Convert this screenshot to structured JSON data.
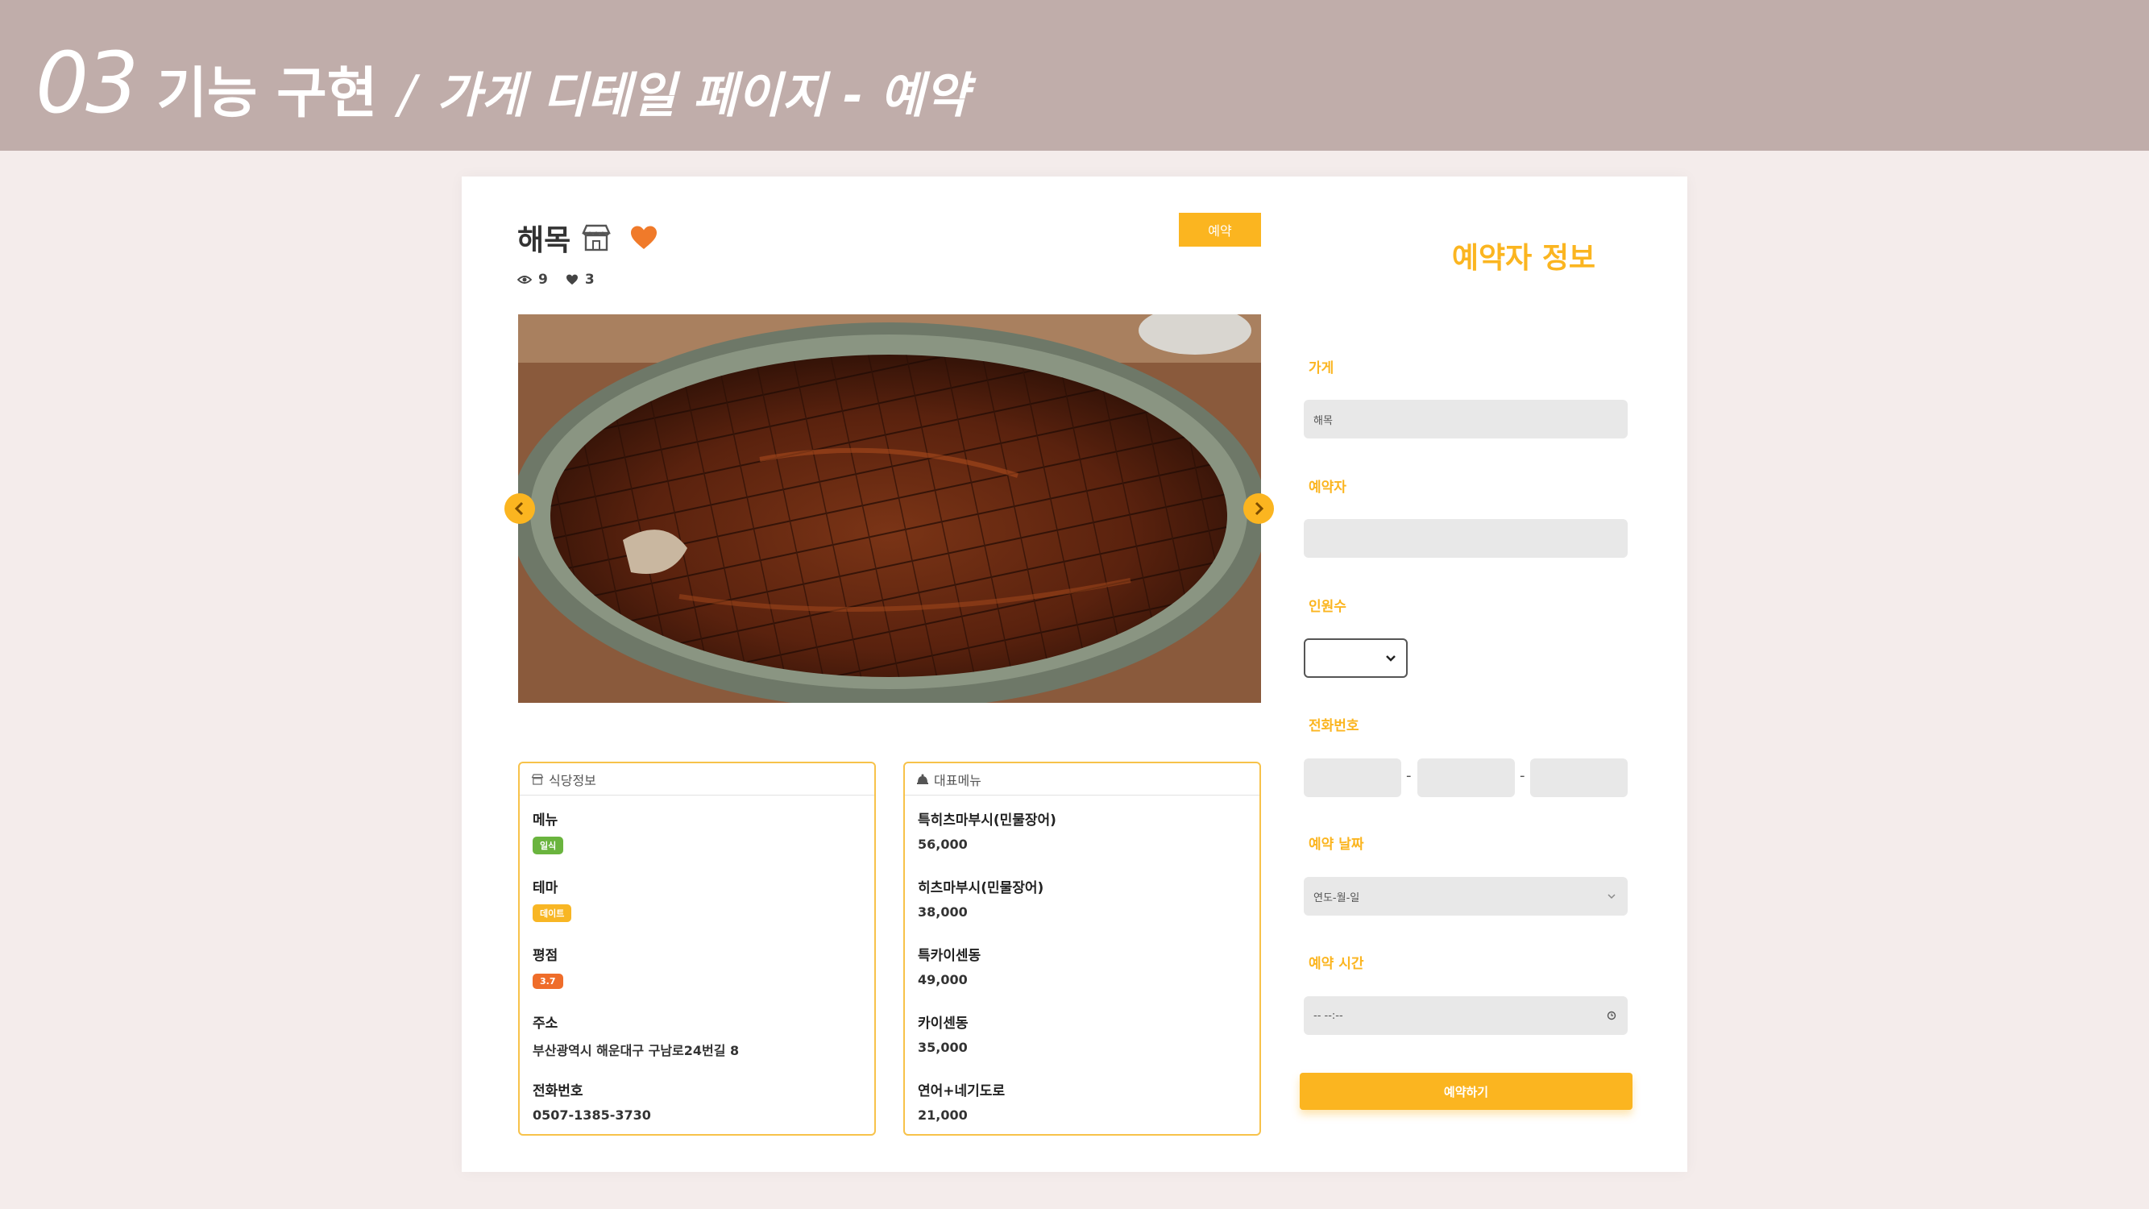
{
  "slide": {
    "number": "03",
    "title": "기능 구현",
    "separator": "/",
    "subtitle": "가게 디테일 페이지 - 예약"
  },
  "store": {
    "name": "해목",
    "views": "9",
    "likes": "3",
    "reserve_button": "예약"
  },
  "restaurant_info": {
    "header": "식당정보",
    "items": [
      {
        "label": "메뉴",
        "badge": "일식",
        "badge_color": "#6ab43e"
      },
      {
        "label": "테마",
        "badge": "데이트",
        "badge_color": "#f8b624"
      },
      {
        "label": "평점",
        "badge": "3.7",
        "badge_color": "#ef6d2a"
      },
      {
        "label": "주소",
        "value": "부산광역시 해운대구 구남로24번길 8"
      },
      {
        "label": "전화번호",
        "value": "0507-1385-3730"
      }
    ]
  },
  "menu_info": {
    "header": "대표메뉴",
    "items": [
      {
        "name": "특히츠마부시(민물장어)",
        "price": "56,000"
      },
      {
        "name": "히츠마부시(민물장어)",
        "price": "38,000"
      },
      {
        "name": "특카이센동",
        "price": "49,000"
      },
      {
        "name": "카이센동",
        "price": "35,000"
      },
      {
        "name": "연어+네기도로",
        "price": "21,000"
      }
    ]
  },
  "form": {
    "title": "예약자 정보",
    "store_label": "가게",
    "store_value": "해목",
    "reserver_label": "예약자",
    "people_label": "인원수",
    "phone_label": "전화번호",
    "phone_dash": "-",
    "date_label": "예약 날짜",
    "date_placeholder": "연도-월-일",
    "time_label": "예약 시간",
    "time_placeholder": "-- --:--",
    "submit": "예약하기"
  },
  "colors": {
    "accent": "#fbb520",
    "header_bg": "#c0adaa",
    "page_bg": "#f4eceb",
    "heart": "#f07a2a"
  }
}
